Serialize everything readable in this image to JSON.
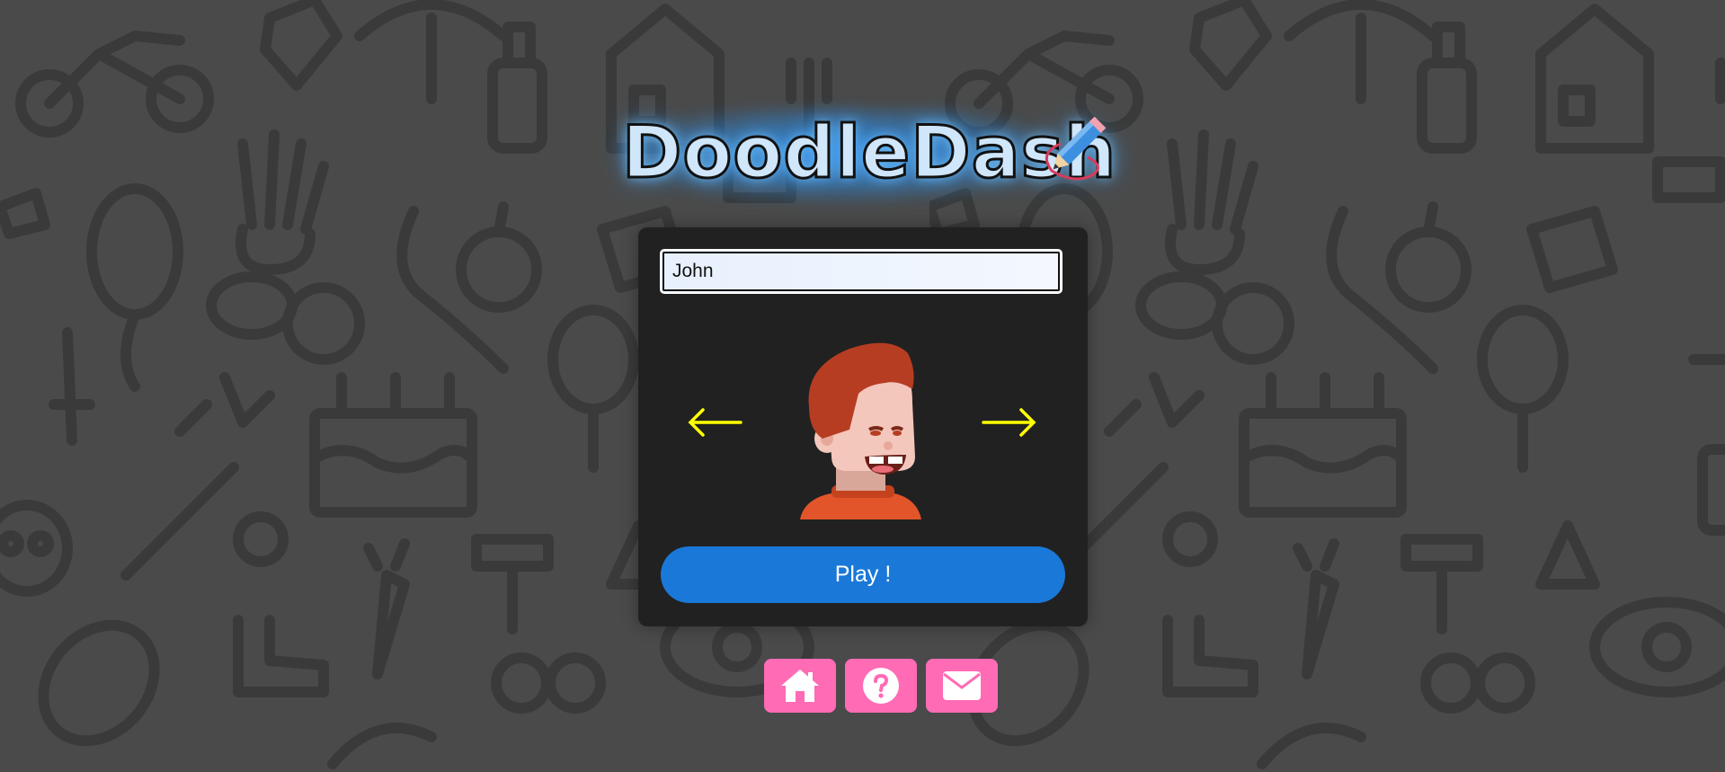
{
  "app": {
    "title": "DoodleDash"
  },
  "form": {
    "name_value": "John"
  },
  "buttons": {
    "play_label": "Play !"
  },
  "icons": {
    "prev": "arrow-left-icon",
    "next": "arrow-right-icon",
    "home": "home-icon",
    "help": "question-icon",
    "mail": "envelope-icon",
    "logo_decoration": "pencil-icon"
  },
  "colors": {
    "background": "#4a4a4a",
    "panel": "#212121",
    "play_button": "#1a78d8",
    "nav_button": "#ff6bb5",
    "arrow": "#ffff00",
    "logo_glow": "#2896ff"
  }
}
